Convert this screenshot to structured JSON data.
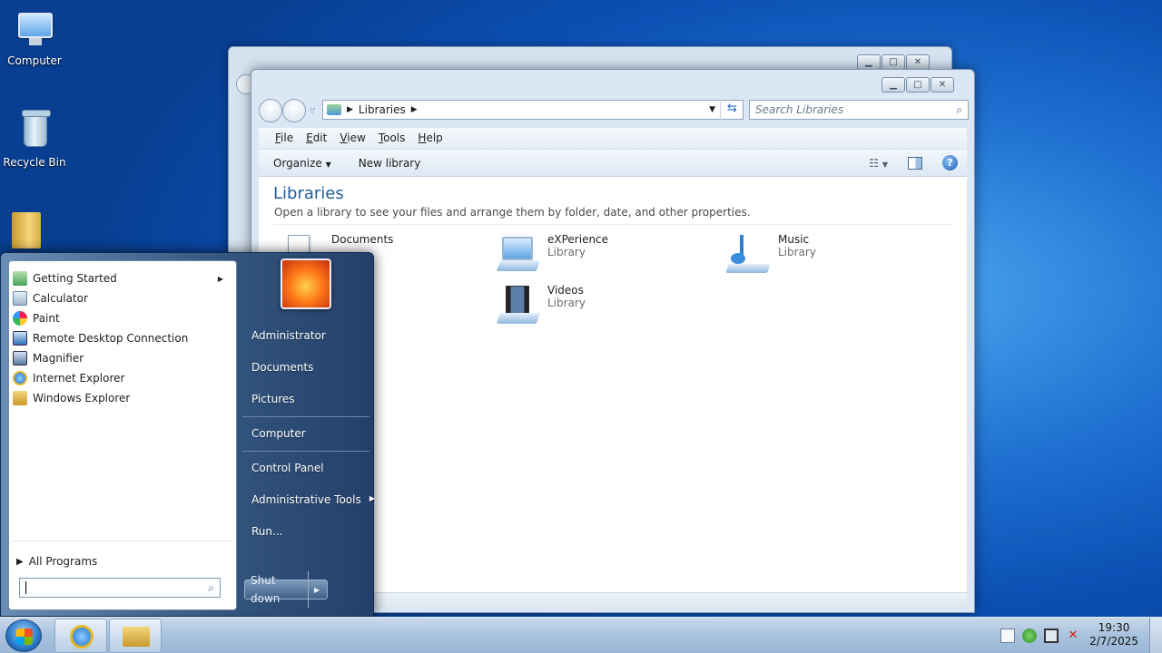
{
  "desktop": {
    "icons": [
      {
        "label": "Computer",
        "icon": "computer-icon"
      },
      {
        "label": "Recycle Bin",
        "icon": "recycle-bin-icon"
      },
      {
        "label": "",
        "icon": "folder-icon"
      }
    ]
  },
  "explorer": {
    "breadcrumb": [
      "Libraries"
    ],
    "search_placeholder": "Search Libraries",
    "menu": [
      "File",
      "Edit",
      "View",
      "Tools",
      "Help"
    ],
    "commands": {
      "organize": "Organize",
      "new_library": "New library"
    },
    "heading": "Libraries",
    "subheading": "Open a library to see your files and arrange them by folder, date, and other properties.",
    "libraries": [
      {
        "name": "Documents",
        "type": ""
      },
      {
        "name": "eXPerience",
        "type": "Library"
      },
      {
        "name": "Music",
        "type": "Library"
      },
      {
        "name": "Videos",
        "type": "Library"
      }
    ]
  },
  "start_menu": {
    "programs": [
      {
        "label": "Getting Started",
        "has_submenu": true,
        "icon": "getting-started-icon"
      },
      {
        "label": "Calculator",
        "icon": "calculator-icon"
      },
      {
        "label": "Paint",
        "icon": "paint-icon"
      },
      {
        "label": "Remote Desktop Connection",
        "icon": "remote-desktop-icon"
      },
      {
        "label": "Magnifier",
        "icon": "magnifier-icon"
      },
      {
        "label": "Internet Explorer",
        "icon": "internet-explorer-icon"
      },
      {
        "label": "Windows Explorer",
        "icon": "windows-explorer-icon"
      }
    ],
    "all_programs": "All Programs",
    "search_value": "",
    "right_items": [
      {
        "label": "Administrator"
      },
      {
        "label": "Documents"
      },
      {
        "label": "Pictures"
      },
      {
        "label": "Computer"
      },
      {
        "label": "Control Panel"
      },
      {
        "label": "Administrative Tools",
        "has_submenu": true
      },
      {
        "label": "Run..."
      }
    ],
    "shutdown": "Shut down"
  },
  "taskbar": {
    "time": "19:30",
    "date": "2/7/2025"
  },
  "colors": {
    "accent": "#1e5d96",
    "desktop": "#1e6fd0"
  }
}
